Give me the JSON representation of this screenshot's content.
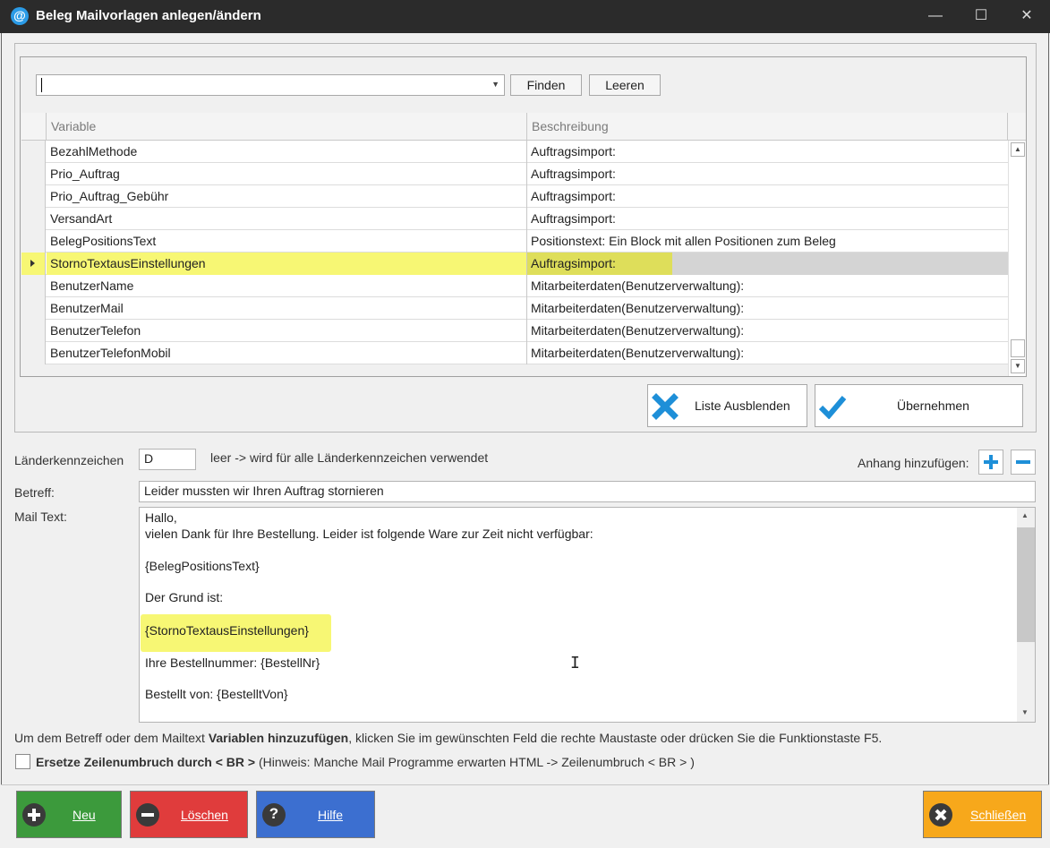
{
  "window": {
    "title": "Beleg Mailvorlagen anlegen/ändern",
    "icon": "@",
    "minimize": "—",
    "maximize": "☐",
    "close": "✕"
  },
  "search": {
    "value": "",
    "find_label": "Finden",
    "clear_label": "Leeren"
  },
  "grid": {
    "columns": [
      "Variable",
      "Beschreibung"
    ],
    "rows": [
      {
        "variable": "BezahlMethode",
        "description": "Auftragsimport:"
      },
      {
        "variable": "Prio_Auftrag",
        "description": "Auftragsimport:"
      },
      {
        "variable": "Prio_Auftrag_Gebühr",
        "description": "Auftragsimport:"
      },
      {
        "variable": "VersandArt",
        "description": "Auftragsimport:"
      },
      {
        "variable": "BelegPositionsText",
        "description": "Positionstext: Ein Block mit allen Positionen zum Beleg"
      },
      {
        "variable": "StornoTextausEinstellungen",
        "description": "Auftragsimport:"
      },
      {
        "variable": "BenutzerName",
        "description": "Mitarbeiterdaten(Benutzerverwaltung):"
      },
      {
        "variable": "BenutzerMail",
        "description": "Mitarbeiterdaten(Benutzerverwaltung):"
      },
      {
        "variable": "BenutzerTelefon",
        "description": "Mitarbeiterdaten(Benutzerverwaltung):"
      },
      {
        "variable": "BenutzerTelefonMobil",
        "description": "Mitarbeiterdaten(Benutzerverwaltung):"
      }
    ],
    "selected_variable": "StornoTextausEinstellungen"
  },
  "actions": {
    "hide_list_label": "Liste Ausblenden",
    "apply_label": "Übernehmen"
  },
  "form": {
    "country_label": "Länderkennzeichen",
    "country_value": "D",
    "country_hint": "leer -> wird für alle Länderkennzeichen verwendet",
    "attachment_label": "Anhang hinzufügen:",
    "subject_label": "Betreff:",
    "subject_value": "Leider mussten wir Ihren Auftrag stornieren",
    "mailtext_label": "Mail Text:",
    "mailtext_lines": [
      "Hallo,",
      "vielen Dank für Ihre Bestellung. Leider ist folgende Ware zur Zeit nicht verfügbar:",
      "{BelegPositionsText}",
      "Der Grund ist:",
      "{StornoTextausEinstellungen}",
      "Ihre Bestellnummer:  {BestellNr}",
      "Bestellt von:  {BestelltVon}"
    ]
  },
  "hint": {
    "part1": "Um dem Betreff oder dem Mailtext ",
    "bold": "Variablen hinzuzufügen",
    "part2": ", klicken Sie im gewünschten Feld die rechte Maustaste oder drücken Sie die Funktionstaste F5."
  },
  "linebreak_option": {
    "checked": false,
    "bold_label": "Ersetze Zeilenumbruch durch < BR >",
    "note": "(Hinweis: Manche Mail Programme erwarten HTML -> Zeilenumbruch <  BR > )"
  },
  "footer": {
    "new_label": "Neu",
    "delete_label": "Löschen",
    "help_label": "Hilfe",
    "close_label": "Schließen"
  },
  "colors": {
    "highlight": "#f7f774",
    "new_button": "#3c9a3c",
    "delete_button": "#e03c3c",
    "help_button": "#3c6fd0",
    "close_button": "#f7a81b",
    "accent_blue": "#1e8fd8"
  }
}
